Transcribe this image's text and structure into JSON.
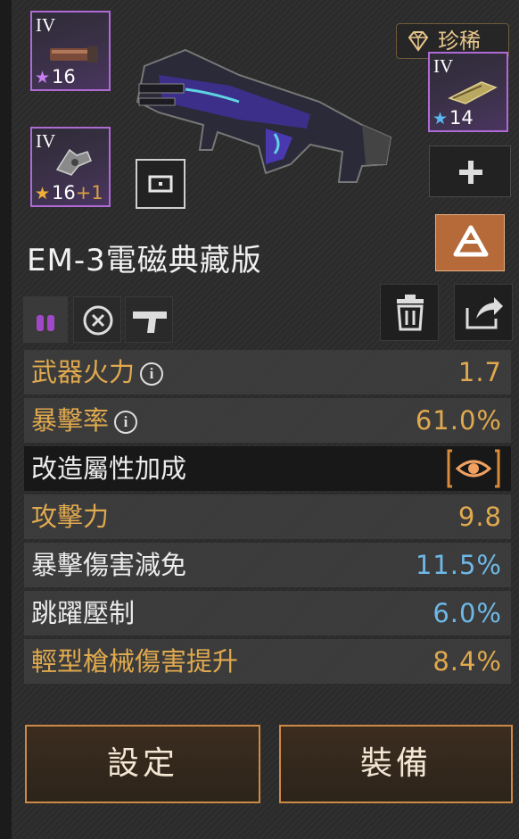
{
  "attachments": [
    {
      "tier": "IV",
      "level": "16",
      "bonus": "",
      "star_color": "#c77ef0"
    },
    {
      "tier": "IV",
      "level": "16",
      "bonus": "+1",
      "star_color": "#f0b038"
    },
    {
      "tier": "IV",
      "level": "14",
      "bonus": "",
      "star_color": "#5ab8f0"
    }
  ],
  "rarity": {
    "label": "珍稀"
  },
  "weapon": {
    "name": "EM-3電磁典藏版"
  },
  "stats": [
    {
      "label": "武器火力",
      "value": "1.7",
      "label_color": "orange",
      "value_color": "orange",
      "info": true
    },
    {
      "label": "暴擊率",
      "value": "61.0%",
      "label_color": "orange",
      "value_color": "orange",
      "info": true
    },
    {
      "label": "改造屬性加成",
      "value": "",
      "label_color": "white"
    },
    {
      "label": "攻擊力",
      "value": "9.8",
      "label_color": "orange",
      "value_color": "orange"
    },
    {
      "label": "暴擊傷害減免",
      "value": "11.5%",
      "label_color": "white",
      "value_color": "blue"
    },
    {
      "label": "跳躍壓制",
      "value": "6.0%",
      "label_color": "white",
      "value_color": "blue"
    },
    {
      "label": "輕型槍械傷害提升",
      "value": "8.4%",
      "label_color": "orange",
      "value_color": "orange"
    }
  ],
  "buttons": {
    "settings": "設定",
    "equip": "裝備"
  },
  "colors": {
    "accent": "#cd8a44",
    "orange": "#e0a94e",
    "blue": "#6eb8e6",
    "purple_border": "#b06ad6"
  }
}
